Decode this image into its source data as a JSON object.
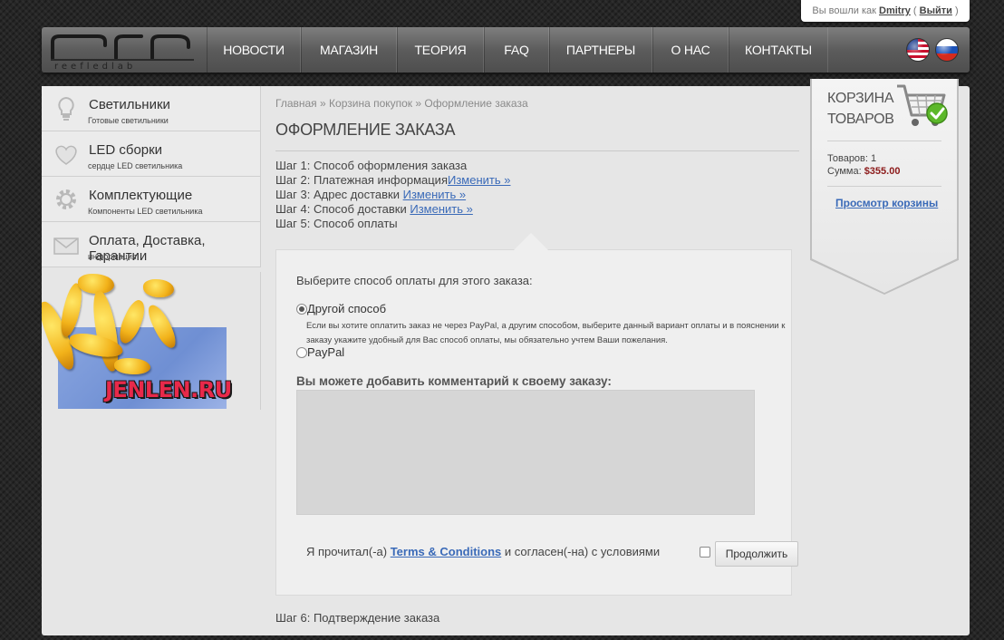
{
  "login": {
    "prefix": "Вы вошли как",
    "username": "Dmitry",
    "open_paren": "(",
    "logout": "Выйти",
    "close_paren": ")"
  },
  "brand": {
    "logo_text": "reefledlab"
  },
  "nav": {
    "items": [
      {
        "label": "НОВОСТИ"
      },
      {
        "label": "МАГАЗИН"
      },
      {
        "label": "ТЕОРИЯ"
      },
      {
        "label": "FAQ"
      },
      {
        "label": "ПАРТНЕРЫ"
      },
      {
        "label": "О НАС"
      },
      {
        "label": "КОНТАКТЫ"
      }
    ],
    "flags": [
      "us-flag-icon",
      "ru-flag-icon"
    ]
  },
  "sidebar": {
    "items": [
      {
        "title": "Светильники",
        "subtitle": "Готовые светильники",
        "icon": "lamp-icon"
      },
      {
        "title": "LED сборки",
        "subtitle": "сердце LED светильника",
        "icon": "heart-icon"
      },
      {
        "title": "Комплектующие",
        "subtitle": "Компоненты LED светильника",
        "icon": "gear-icon"
      },
      {
        "title": "Оплата, Доставка, Гарантии",
        "subtitle": "информация",
        "icon": "mail-icon"
      }
    ],
    "promo_text": "JENLEN.RU"
  },
  "breadcrumb": {
    "home": "Главная",
    "sep1": " » ",
    "cart": "Корзина покупок",
    "sep2": " » ",
    "current": "Оформление заказа"
  },
  "page": {
    "title": "ОФОРМЛЕНИЕ ЗАКАЗА",
    "steps": [
      {
        "text": "Шаг 1: Способ оформления заказа",
        "link": ""
      },
      {
        "text": "Шаг 2: Платежная информация",
        "link": "Изменить »"
      },
      {
        "text": "Шаг 3: Адрес доставки ",
        "link": "Изменить »"
      },
      {
        "text": "Шаг 4: Способ доставки ",
        "link": "Изменить »"
      },
      {
        "text": "Шаг 5: Способ оплаты",
        "link": ""
      }
    ],
    "step6": "Шаг 6: Подтверждение заказа"
  },
  "payment": {
    "prompt": "Выберите способ оплаты для этого заказа:",
    "options": [
      {
        "label": "Другой способ",
        "checked": true,
        "description": "Если вы хотите оплатить заказ не через PayPal, а другим способом, выберите данный вариант оплаты и в пояснении к заказу укажите удобный для Вас способ оплаты, мы обязательно учтем Ваши пожелания."
      },
      {
        "label": "PayPal",
        "checked": false
      }
    ],
    "comment_label": "Вы можете добавить комментарий к своему заказу:",
    "comment_value": "",
    "terms_prefix": "Я прочитал(-а) ",
    "terms_link": "Terms & Conditions",
    "terms_suffix": " и согласен(-на) с условиями",
    "terms_checked": false,
    "continue_label": "Продолжить"
  },
  "cart": {
    "title_line1": "КОРЗИНА",
    "title_line2": "ТОВАРОВ",
    "items_label": "Товаров: 1",
    "sum_label": "Сумма: ",
    "sum_value": "$355.00",
    "view_link": "Просмотр корзины"
  },
  "colors": {
    "link": "#3a6ab8",
    "sum": "#8c1a1a",
    "nav_bg": "#5c5c5c"
  }
}
